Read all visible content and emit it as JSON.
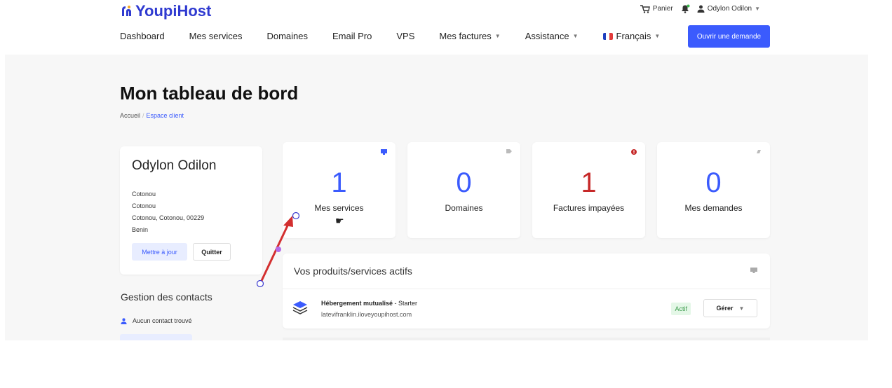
{
  "brand": {
    "name": "YoupiHost"
  },
  "toolbar": {
    "cart_label": "Panier",
    "user_name": "Odylon Odilon"
  },
  "nav": {
    "items": [
      {
        "label": "Dashboard"
      },
      {
        "label": "Mes services"
      },
      {
        "label": "Domaines"
      },
      {
        "label": "Email Pro"
      },
      {
        "label": "VPS"
      },
      {
        "label": "Mes factures"
      },
      {
        "label": "Assistance"
      },
      {
        "label": "Français"
      }
    ],
    "cta_label": "Ouvrir une demande"
  },
  "page": {
    "title": "Mon tableau de bord",
    "breadcrumb": [
      "Accueil",
      "Espace client"
    ]
  },
  "profile": {
    "name": "Odylon Odilon",
    "address_lines": [
      "Cotonou",
      "Cotonou",
      "Cotonou, Cotonou, 00229",
      "Benin"
    ],
    "update_label": "Mettre à jour",
    "quit_label": "Quitter"
  },
  "contacts": {
    "title": "Gestion des contacts",
    "empty_label": "Aucun contact trouvé"
  },
  "stats": [
    {
      "value": "1",
      "label": "Mes services",
      "color": "#3b5bfd",
      "icon": "monitor-icon"
    },
    {
      "value": "0",
      "label": "Domaines",
      "color": "#3b5bfd",
      "icon": "tag-icon"
    },
    {
      "value": "1",
      "label": "Factures impayées",
      "color": "#c62828",
      "icon": "alert-icon"
    },
    {
      "value": "0",
      "label": "Mes demandes",
      "color": "#3b5bfd",
      "icon": "comment-icon"
    }
  ],
  "services": {
    "title": "Vos produits/services actifs",
    "items": [
      {
        "name": "Hébergement mutualisé",
        "plan": " - Starter",
        "domain": "latevifranklin.iloveyoupihost.com",
        "status": "Actif",
        "manage_label": "Gérer"
      }
    ]
  },
  "colors": {
    "accent": "#3b5bfd",
    "danger": "#c62828",
    "success": "#3a9b4b",
    "annotation": "#d32f2f"
  }
}
